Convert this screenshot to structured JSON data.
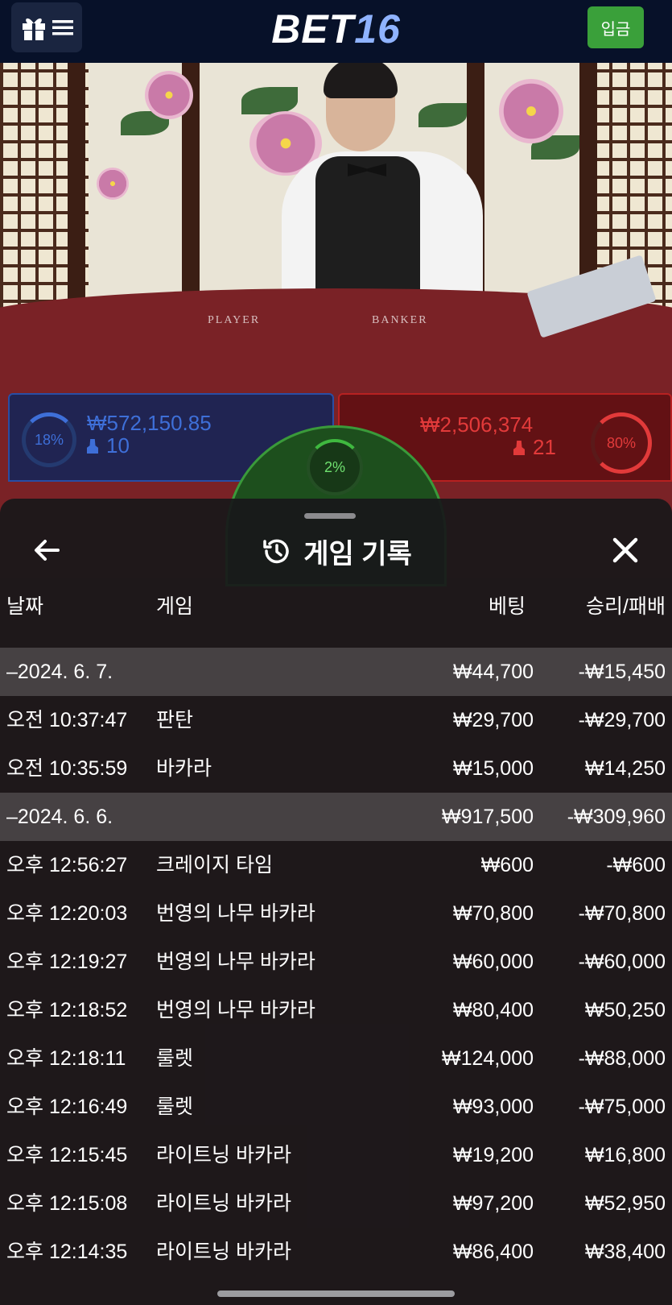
{
  "header": {
    "logo_text": "BET",
    "logo_number": "16",
    "deposit_label": "입금",
    "menu_icons": [
      "gift-icon",
      "hamburger-icon"
    ]
  },
  "live_table": {
    "table_labels": [
      "PLAYER",
      "BANKER"
    ],
    "player": {
      "percent": "18%",
      "amount": "₩572,150.85",
      "count": "10"
    },
    "tie": {
      "percent": "2%"
    },
    "banker": {
      "percent": "80%",
      "amount": "₩2,506,374",
      "count": "21"
    },
    "colors": {
      "player": "#3e6fd8",
      "banker": "#e23a3a",
      "tie": "#3fb83f"
    }
  },
  "history": {
    "title": "게임 기록",
    "columns": {
      "date": "날짜",
      "game": "게임",
      "bet": "베팅",
      "result": "승리/패배"
    },
    "rows": [
      {
        "type": "date",
        "time": "–2024. 6. 7.",
        "game": "",
        "bet": "₩44,700",
        "result": "-₩15,450"
      },
      {
        "type": "entry",
        "time": "오전 10:37:47",
        "game": "판탄",
        "bet": "₩29,700",
        "result": "-₩29,700"
      },
      {
        "type": "entry",
        "time": "오전 10:35:59",
        "game": "바카라",
        "bet": "₩15,000",
        "result": "₩14,250"
      },
      {
        "type": "date",
        "time": "–2024. 6. 6.",
        "game": "",
        "bet": "₩917,500",
        "result": "-₩309,960"
      },
      {
        "type": "entry",
        "time": "오후 12:56:27",
        "game": "크레이지 타임",
        "bet": "₩600",
        "result": "-₩600"
      },
      {
        "type": "entry",
        "time": "오후 12:20:03",
        "game": "번영의 나무 바카라",
        "bet": "₩70,800",
        "result": "-₩70,800"
      },
      {
        "type": "entry",
        "time": "오후 12:19:27",
        "game": "번영의 나무 바카라",
        "bet": "₩60,000",
        "result": "-₩60,000"
      },
      {
        "type": "entry",
        "time": "오후 12:18:52",
        "game": "번영의 나무 바카라",
        "bet": "₩80,400",
        "result": "₩50,250"
      },
      {
        "type": "entry",
        "time": "오후 12:18:11",
        "game": "룰렛",
        "bet": "₩124,000",
        "result": "-₩88,000"
      },
      {
        "type": "entry",
        "time": "오후 12:16:49",
        "game": "룰렛",
        "bet": "₩93,000",
        "result": "-₩75,000"
      },
      {
        "type": "entry",
        "time": "오후 12:15:45",
        "game": "라이트닝 바카라",
        "bet": "₩19,200",
        "result": "₩16,800"
      },
      {
        "type": "entry",
        "time": "오후 12:15:08",
        "game": "라이트닝 바카라",
        "bet": "₩97,200",
        "result": "₩52,950"
      },
      {
        "type": "entry",
        "time": "오후 12:14:35",
        "game": "라이트닝 바카라",
        "bet": "₩86,400",
        "result": "₩38,400"
      }
    ]
  }
}
